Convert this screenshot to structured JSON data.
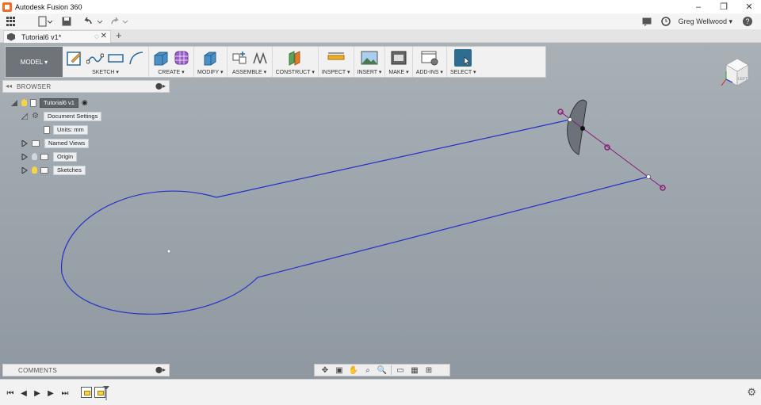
{
  "window": {
    "title": "Autodesk Fusion 360",
    "controls": [
      "–",
      "❐",
      "✕"
    ]
  },
  "qat": {
    "user": "Greg Wellwood ▾",
    "help": "?"
  },
  "document_tab": {
    "label": "Tutorial6 v1*",
    "status_icon": "◌",
    "close": "✕",
    "new_tab": "+"
  },
  "toolbar": {
    "mode": "MODEL ▾",
    "groups": {
      "sketch": "SKETCH ▾",
      "create": "CREATE ▾",
      "modify": "MODIFY ▾",
      "assemble": "ASSEMBLE ▾",
      "construct": "CONSTRUCT ▾",
      "inspect": "INSPECT ▾",
      "insert": "INSERT ▾",
      "make": "MAKE ▾",
      "addins": "ADD-INS ▾",
      "select": "SELECT ▾"
    }
  },
  "browser": {
    "title": "BROWSER",
    "root": "Tutorial6 v1",
    "document_settings": "Document Settings",
    "units": "Units: mm",
    "named_views": "Named Views",
    "origin": "Origin",
    "sketches": "Sketches"
  },
  "comments": {
    "title": "COMMENTS"
  },
  "viewcube": {
    "face_label": "LEFT"
  },
  "colors": {
    "sketch_line": "#2231c9",
    "constraint": "#8b1a7a",
    "select_active": "#2e6d8f"
  }
}
